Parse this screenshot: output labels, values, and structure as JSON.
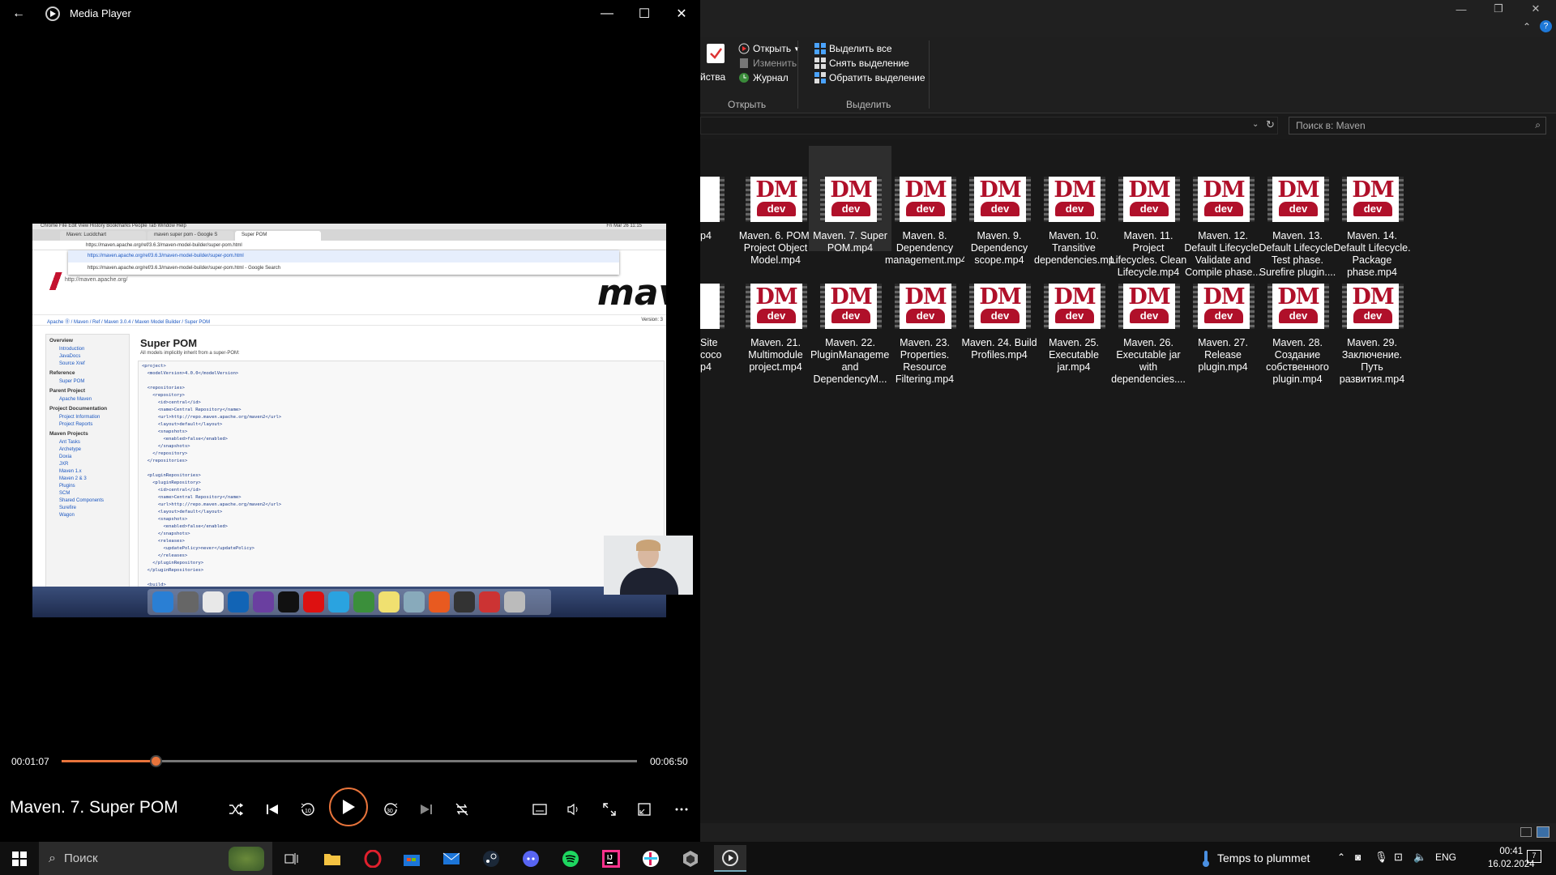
{
  "explorer": {
    "ribbon": {
      "properties_label": "йства",
      "open_label": "Открыть",
      "edit_label": "Изменить",
      "history_label": "Журнал",
      "select_all_label": "Выделить все",
      "deselect_label": "Снять выделение",
      "invert_label": "Обратить выделение",
      "group_open": "Открыть",
      "group_select": "Выделить"
    },
    "search_placeholder": "Поиск в: Maven",
    "files_row1": [
      {
        "name": "Maven. 6. POM. Project Object Model.mp4"
      },
      {
        "name": "Maven. 7. Super POM.mp4"
      },
      {
        "name": "Maven. 8. Dependency management.mp4"
      },
      {
        "name": "Maven. 9. Dependency scope.mp4"
      },
      {
        "name": "Maven. 10. Transitive dependencies.mp4"
      },
      {
        "name": "Maven. 11. Project Lifecycles. Clean Lifecycle.mp4"
      },
      {
        "name": "Maven. 12. Default Lifecycle. Validate and Compile phase..."
      },
      {
        "name": "Maven. 13. Default Lifecycle. Test phase. Surefire plugin...."
      },
      {
        "name": "Maven. 14. Default Lifecycle. Package phase.mp4"
      }
    ],
    "files_row2": [
      {
        "name": "Maven. 21. Multimodule project.mp4"
      },
      {
        "name": "Maven. 22. PluginManagement and DependencyM..."
      },
      {
        "name": "Maven. 23. Properties. Resource Filtering.mp4"
      },
      {
        "name": "Maven. 24. Build Profiles.mp4"
      },
      {
        "name": "Maven. 25. Executable jar.mp4"
      },
      {
        "name": "Maven. 26. Executable jar with dependencies...."
      },
      {
        "name": "Maven. 27. Release plugin.mp4"
      },
      {
        "name": "Maven. 28. Создание собственного plugin.mp4"
      },
      {
        "name": "Maven. 29. Заключение. Путь развития.mp4"
      }
    ],
    "partial_row1": [
      "p4"
    ],
    "partial_row2": [
      "Site",
      "coco",
      "p4"
    ],
    "thumb_dm": "DM",
    "thumb_dev": "dev"
  },
  "player": {
    "window_title": "Media Player",
    "now_playing": "Maven. 7. Super POM",
    "time_current": "00:01:07",
    "time_total": "00:06:50",
    "progress_fraction": 0.163,
    "accent_color": "#e8743b"
  },
  "video": {
    "mac_menu": "Chrome   File   Edit   View   History   Bookmarks   People   Tab   Window   Help",
    "mac_clock": "Fri Mar 26 11:15",
    "tabs": [
      "Maven: Lucidchart",
      "maven super pom - Google S",
      "Super POM"
    ],
    "url": "https://maven.apache.org/ref/3.6.3/maven-model-builder/super-pom.html",
    "suggest_1": "https://maven.apache.org/ref/3.6.3/maven-model-builder/super-pom.html",
    "suggest_2": "https://maven.apache.org/ref/3.6.3/maven-model-builder/super-pom.html - Google Search",
    "site_url": "http://maven.apache.org/",
    "logo": "mav",
    "breadcrumbs": "Apache ⓪  /  Maven  /  Ref  /  Maven 3.0.4  /  Maven Model Builder  /  Super POM",
    "version_label": "Version: 3",
    "side": {
      "overview": "Overview",
      "overview_links": [
        "Introduction",
        "JavaDocs",
        "Source Xref"
      ],
      "reference": "Reference",
      "reference_item": "Super POM",
      "parent": "Parent Project",
      "parent_item": "Apache Maven",
      "docs": "Project Documentation",
      "docs_links": [
        "Project Information",
        "Project Reports"
      ],
      "projects": "Maven Projects",
      "projects_links": [
        "Ant Tasks",
        "Archetype",
        "Doxia",
        "JXR",
        "Maven 1.x",
        "Maven 2 & 3",
        "Plugins",
        "SCM",
        "Shared Components",
        "Surefire",
        "Wagon"
      ]
    },
    "page_title": "Super POM",
    "page_sub": "All models implicitly inherit from a super-POM:",
    "code": "<project>\n  <modelVersion>4.0.0</modelVersion>\n\n  <repositories>\n    <repository>\n      <id>central</id>\n      <name>Central Repository</name>\n      <url>http://repo.maven.apache.org/maven2</url>\n      <layout>default</layout>\n      <snapshots>\n        <enabled>false</enabled>\n      </snapshots>\n    </repository>\n  </repositories>\n\n  <pluginRepositories>\n    <pluginRepository>\n      <id>central</id>\n      <name>Central Repository</name>\n      <url>http://repo.maven.apache.org/maven2</url>\n      <layout>default</layout>\n      <snapshots>\n        <enabled>false</enabled>\n      </snapshots>\n      <releases>\n        <updatePolicy>never</updatePolicy>\n      </releases>\n    </pluginRepository>\n  </pluginRepositories>\n\n  <build>"
  },
  "taskbar": {
    "search_placeholder": "Поиск",
    "weather": "Temps to plummet",
    "lang": "ENG",
    "time": "00:41",
    "date": "16.02.2024",
    "notifications": "7"
  }
}
